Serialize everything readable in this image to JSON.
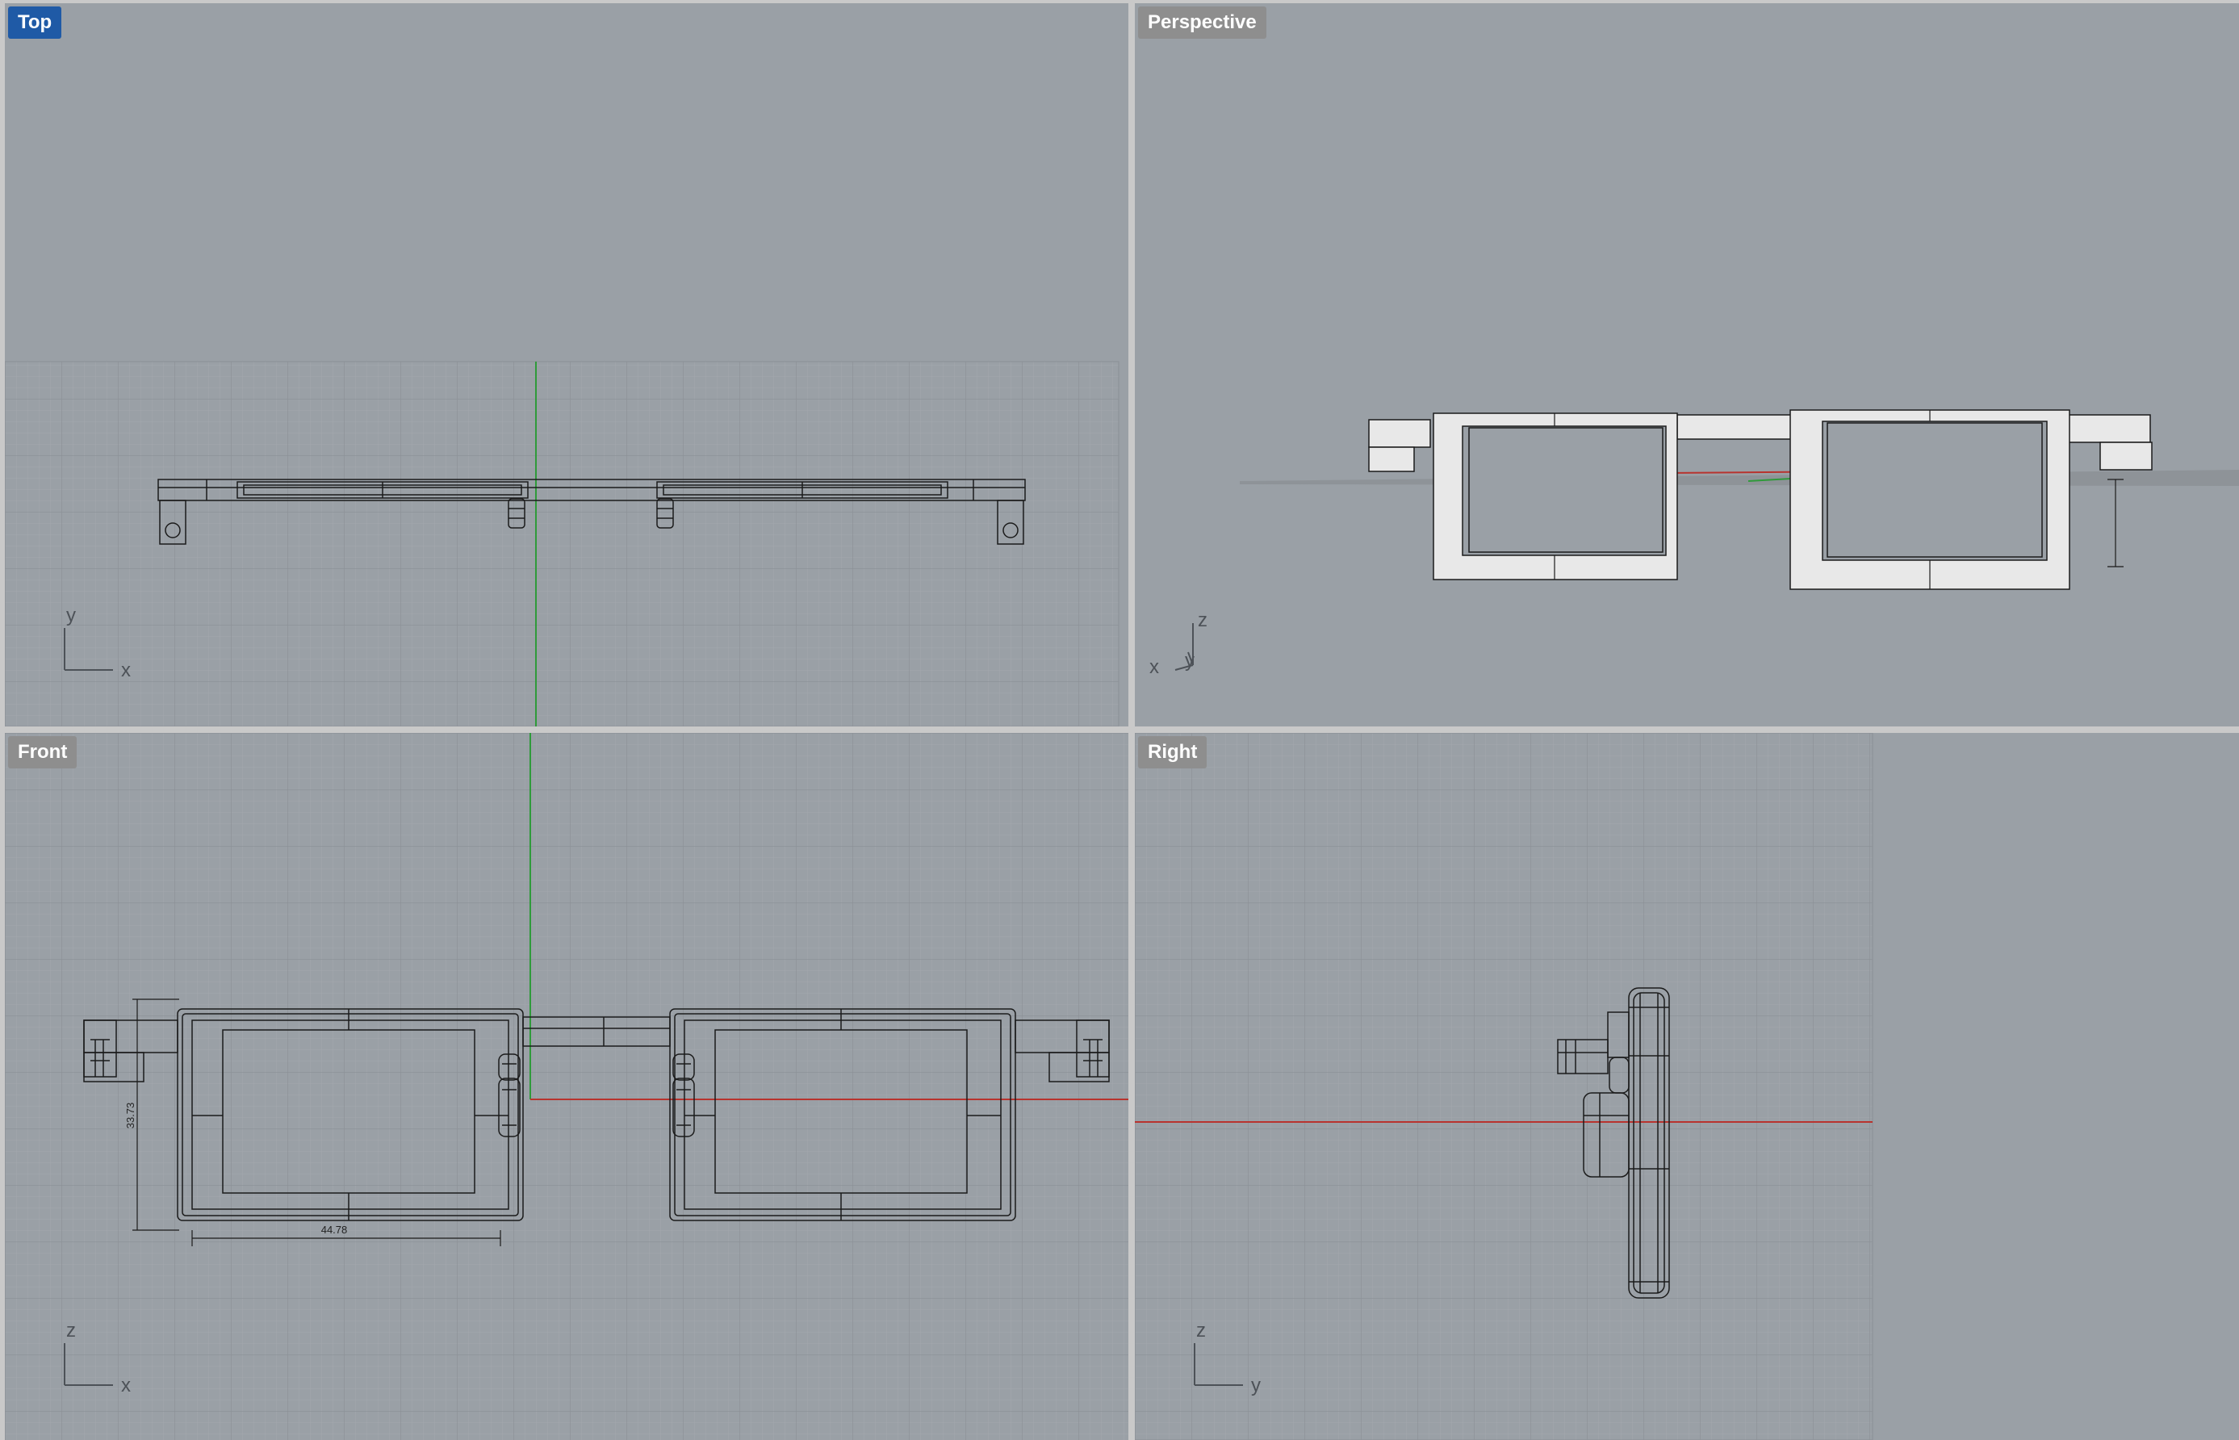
{
  "viewports": {
    "top": {
      "label": "Top",
      "active": true,
      "axis_h": "x",
      "axis_v": "y"
    },
    "perspective": {
      "label": "Perspective",
      "active": false,
      "axis_x": "x",
      "axis_y": "y",
      "axis_z": "z"
    },
    "front": {
      "label": "Front",
      "active": false,
      "axis_h": "x",
      "axis_v": "z"
    },
    "right": {
      "label": "Right",
      "active": false,
      "axis_h": "y",
      "axis_v": "z"
    }
  },
  "dimensions": {
    "front_width": "44.78",
    "front_height": "33.73"
  },
  "colors": {
    "viewport_bg": "#9aa0a6",
    "grid_minor": "#a4a9ae",
    "grid_major": "#8b9096",
    "active_label": "#1f5aa6",
    "axis_x_red": "#b8332e",
    "axis_y_green": "#2f9a3a",
    "wire": "#1b1b1b",
    "frame_fill": "#e8e8e8"
  }
}
